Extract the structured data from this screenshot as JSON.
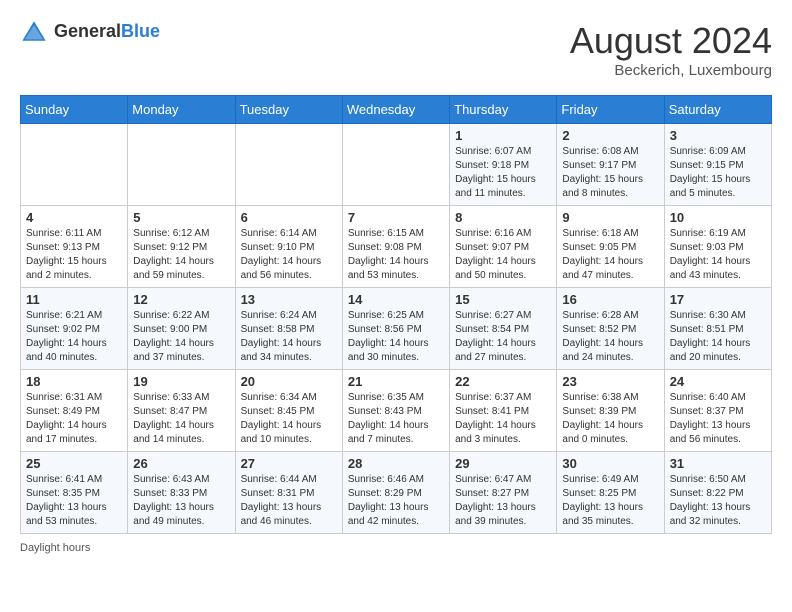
{
  "header": {
    "logo_general": "General",
    "logo_blue": "Blue",
    "month_year": "August 2024",
    "location": "Beckerich, Luxembourg"
  },
  "days_of_week": [
    "Sunday",
    "Monday",
    "Tuesday",
    "Wednesday",
    "Thursday",
    "Friday",
    "Saturday"
  ],
  "weeks": [
    [
      {
        "day": "",
        "info": ""
      },
      {
        "day": "",
        "info": ""
      },
      {
        "day": "",
        "info": ""
      },
      {
        "day": "",
        "info": ""
      },
      {
        "day": "1",
        "info": "Sunrise: 6:07 AM\nSunset: 9:18 PM\nDaylight: 15 hours\nand 11 minutes."
      },
      {
        "day": "2",
        "info": "Sunrise: 6:08 AM\nSunset: 9:17 PM\nDaylight: 15 hours\nand 8 minutes."
      },
      {
        "day": "3",
        "info": "Sunrise: 6:09 AM\nSunset: 9:15 PM\nDaylight: 15 hours\nand 5 minutes."
      }
    ],
    [
      {
        "day": "4",
        "info": "Sunrise: 6:11 AM\nSunset: 9:13 PM\nDaylight: 15 hours\nand 2 minutes."
      },
      {
        "day": "5",
        "info": "Sunrise: 6:12 AM\nSunset: 9:12 PM\nDaylight: 14 hours\nand 59 minutes."
      },
      {
        "day": "6",
        "info": "Sunrise: 6:14 AM\nSunset: 9:10 PM\nDaylight: 14 hours\nand 56 minutes."
      },
      {
        "day": "7",
        "info": "Sunrise: 6:15 AM\nSunset: 9:08 PM\nDaylight: 14 hours\nand 53 minutes."
      },
      {
        "day": "8",
        "info": "Sunrise: 6:16 AM\nSunset: 9:07 PM\nDaylight: 14 hours\nand 50 minutes."
      },
      {
        "day": "9",
        "info": "Sunrise: 6:18 AM\nSunset: 9:05 PM\nDaylight: 14 hours\nand 47 minutes."
      },
      {
        "day": "10",
        "info": "Sunrise: 6:19 AM\nSunset: 9:03 PM\nDaylight: 14 hours\nand 43 minutes."
      }
    ],
    [
      {
        "day": "11",
        "info": "Sunrise: 6:21 AM\nSunset: 9:02 PM\nDaylight: 14 hours\nand 40 minutes."
      },
      {
        "day": "12",
        "info": "Sunrise: 6:22 AM\nSunset: 9:00 PM\nDaylight: 14 hours\nand 37 minutes."
      },
      {
        "day": "13",
        "info": "Sunrise: 6:24 AM\nSunset: 8:58 PM\nDaylight: 14 hours\nand 34 minutes."
      },
      {
        "day": "14",
        "info": "Sunrise: 6:25 AM\nSunset: 8:56 PM\nDaylight: 14 hours\nand 30 minutes."
      },
      {
        "day": "15",
        "info": "Sunrise: 6:27 AM\nSunset: 8:54 PM\nDaylight: 14 hours\nand 27 minutes."
      },
      {
        "day": "16",
        "info": "Sunrise: 6:28 AM\nSunset: 8:52 PM\nDaylight: 14 hours\nand 24 minutes."
      },
      {
        "day": "17",
        "info": "Sunrise: 6:30 AM\nSunset: 8:51 PM\nDaylight: 14 hours\nand 20 minutes."
      }
    ],
    [
      {
        "day": "18",
        "info": "Sunrise: 6:31 AM\nSunset: 8:49 PM\nDaylight: 14 hours\nand 17 minutes."
      },
      {
        "day": "19",
        "info": "Sunrise: 6:33 AM\nSunset: 8:47 PM\nDaylight: 14 hours\nand 14 minutes."
      },
      {
        "day": "20",
        "info": "Sunrise: 6:34 AM\nSunset: 8:45 PM\nDaylight: 14 hours\nand 10 minutes."
      },
      {
        "day": "21",
        "info": "Sunrise: 6:35 AM\nSunset: 8:43 PM\nDaylight: 14 hours\nand 7 minutes."
      },
      {
        "day": "22",
        "info": "Sunrise: 6:37 AM\nSunset: 8:41 PM\nDaylight: 14 hours\nand 3 minutes."
      },
      {
        "day": "23",
        "info": "Sunrise: 6:38 AM\nSunset: 8:39 PM\nDaylight: 14 hours\nand 0 minutes."
      },
      {
        "day": "24",
        "info": "Sunrise: 6:40 AM\nSunset: 8:37 PM\nDaylight: 13 hours\nand 56 minutes."
      }
    ],
    [
      {
        "day": "25",
        "info": "Sunrise: 6:41 AM\nSunset: 8:35 PM\nDaylight: 13 hours\nand 53 minutes."
      },
      {
        "day": "26",
        "info": "Sunrise: 6:43 AM\nSunset: 8:33 PM\nDaylight: 13 hours\nand 49 minutes."
      },
      {
        "day": "27",
        "info": "Sunrise: 6:44 AM\nSunset: 8:31 PM\nDaylight: 13 hours\nand 46 minutes."
      },
      {
        "day": "28",
        "info": "Sunrise: 6:46 AM\nSunset: 8:29 PM\nDaylight: 13 hours\nand 42 minutes."
      },
      {
        "day": "29",
        "info": "Sunrise: 6:47 AM\nSunset: 8:27 PM\nDaylight: 13 hours\nand 39 minutes."
      },
      {
        "day": "30",
        "info": "Sunrise: 6:49 AM\nSunset: 8:25 PM\nDaylight: 13 hours\nand 35 minutes."
      },
      {
        "day": "31",
        "info": "Sunrise: 6:50 AM\nSunset: 8:22 PM\nDaylight: 13 hours\nand 32 minutes."
      }
    ]
  ],
  "footer": {
    "note": "Daylight hours"
  }
}
